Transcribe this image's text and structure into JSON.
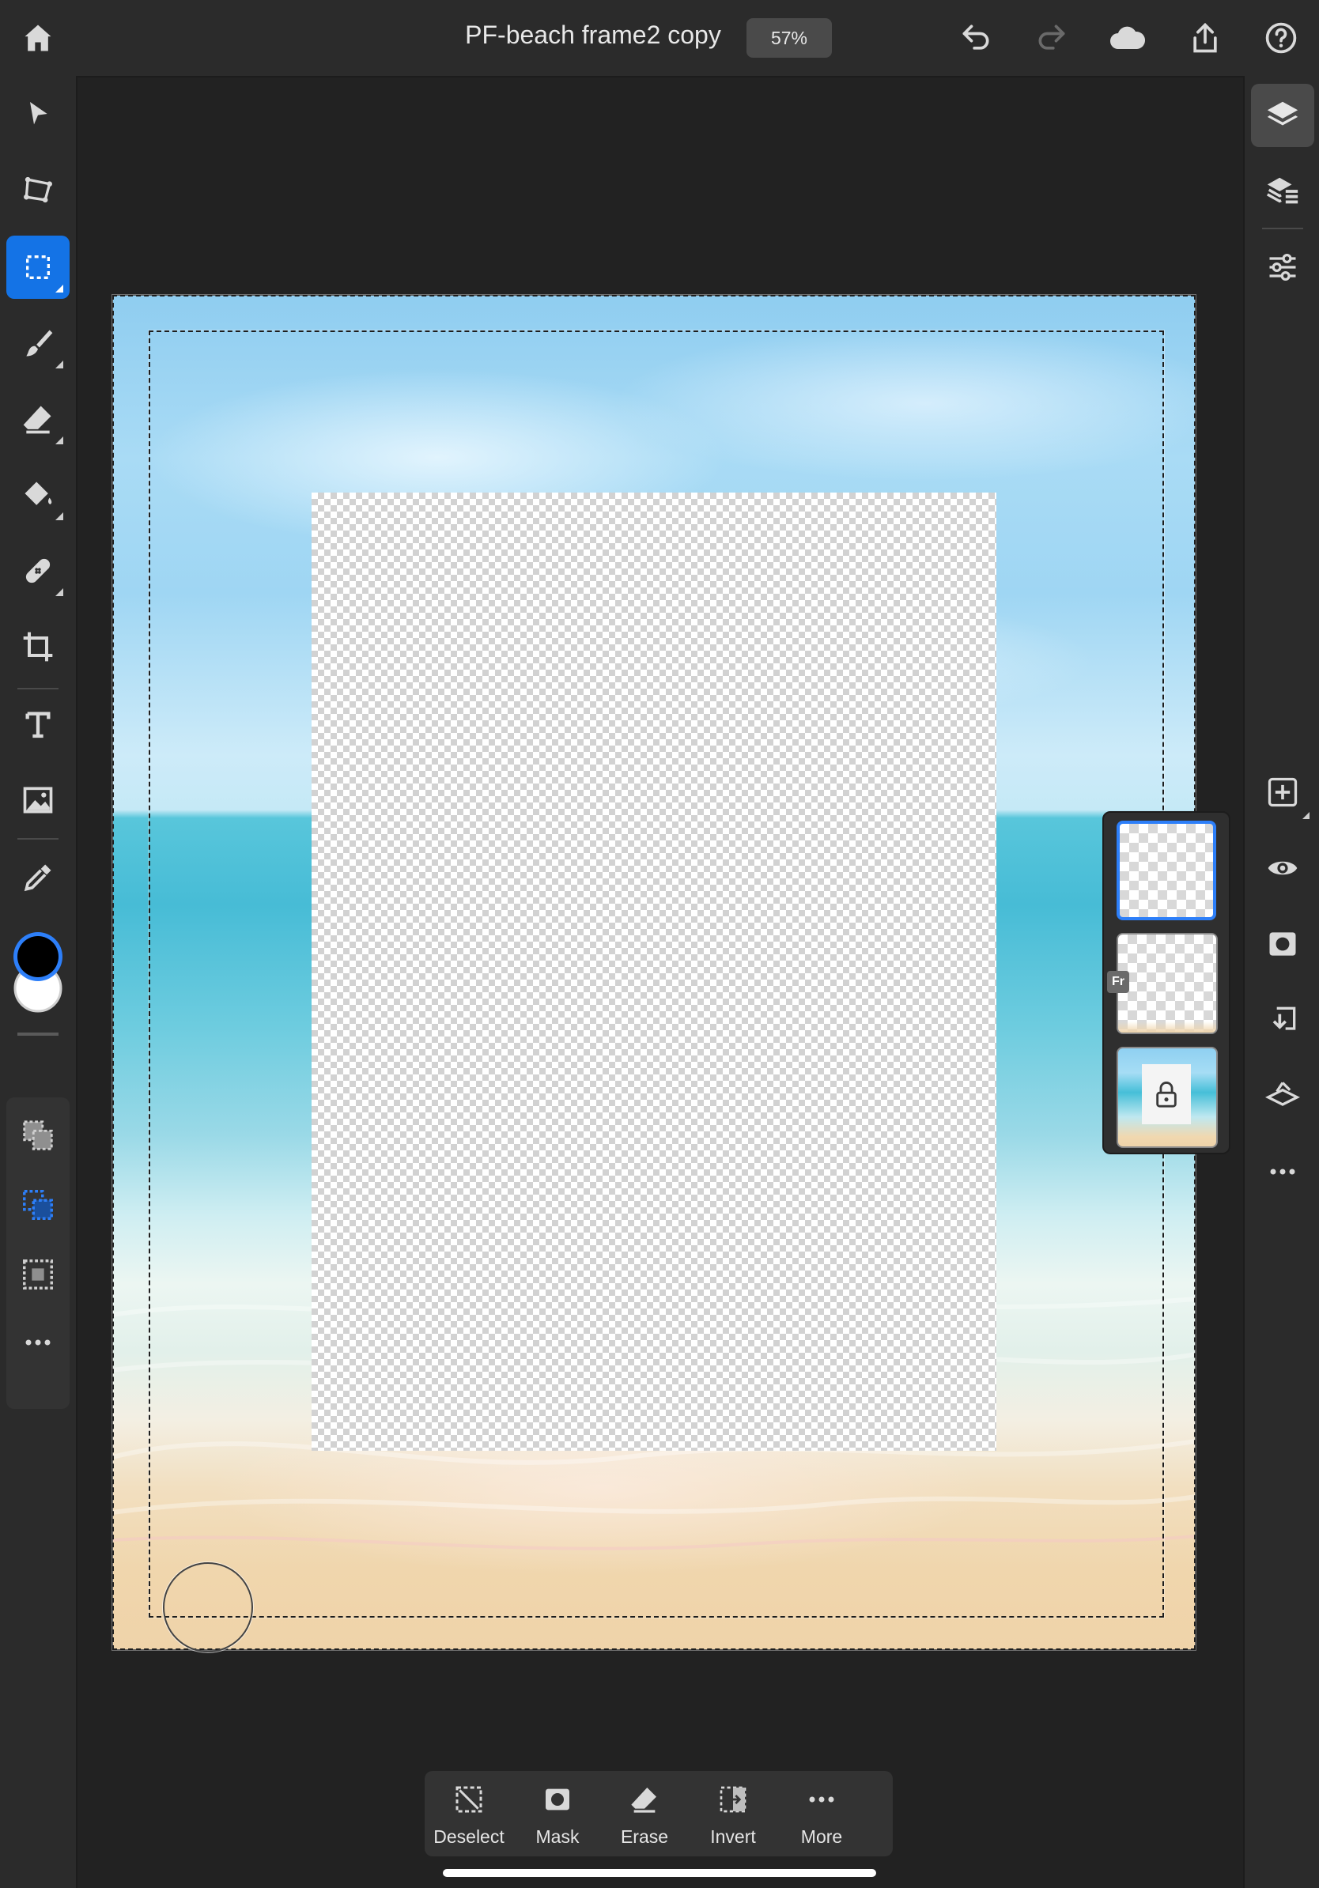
{
  "header": {
    "document_title": "PF-beach frame2 copy",
    "zoom": "57%"
  },
  "layers": {
    "frame_badge": "Fr"
  },
  "selection_taskbar": {
    "deselect": "Deselect",
    "mask": "Mask",
    "erase": "Erase",
    "invert": "Invert",
    "more": "More"
  },
  "colors": {
    "accent": "#1473e6",
    "foreground_color": "#000000",
    "background_color": "#ffffff",
    "ui_background": "#222222",
    "panel": "#2b2b2b"
  }
}
